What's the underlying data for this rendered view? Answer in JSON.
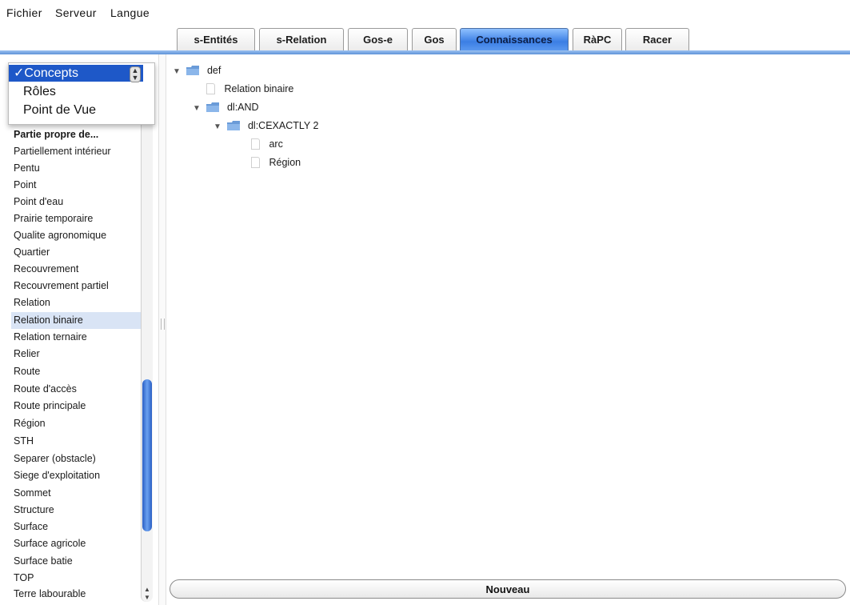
{
  "menubar": {
    "items": [
      "Fichier",
      "Serveur",
      "Langue"
    ]
  },
  "tabs": [
    {
      "label": "s-Entités",
      "active": false
    },
    {
      "label": "s-Relation",
      "active": false
    },
    {
      "label": "Gos-e",
      "active": false
    },
    {
      "label": "Gos",
      "active": false
    },
    {
      "label": "Connaissances",
      "active": true
    },
    {
      "label": "RàPC",
      "active": false
    },
    {
      "label": "Racer",
      "active": false
    }
  ],
  "category_dropdown": {
    "selected": "Concepts",
    "check_mark": "✓",
    "options": [
      "Concepts",
      "Rôles",
      "Point de Vue"
    ]
  },
  "concept_list": {
    "partial_first_item": "Partie propre de...",
    "items": [
      "Partiellement intérieur",
      "Pentu",
      "Point",
      "Point d'eau",
      "Prairie temporaire",
      "Qualite agronomique",
      "Quartier",
      "Recouvrement",
      "Recouvrement partiel",
      "Relation",
      "Relation binaire",
      "Relation ternaire",
      "Relier",
      "Route",
      "Route d'accès",
      "Route principale",
      "Région",
      "STH",
      "Separer (obstacle)",
      "Siege d'exploitation",
      "Sommet",
      "Structure",
      "Surface",
      "Surface agricole",
      "Surface batie",
      "TOP",
      "Terre labourable"
    ],
    "selected": "Relation binaire"
  },
  "tree": {
    "root": "def",
    "child_leaf": "Relation binaire",
    "and_node": "dl:AND",
    "exactly_node": "dl:CEXACTLY 2",
    "leaves": [
      "arc",
      "Région"
    ],
    "expanded_glyph": "▼"
  },
  "actions": {
    "new_label": "Nouveau"
  },
  "colors": {
    "active_tab": "#3b7ee4",
    "selection": "#1e58c8",
    "scroll_thumb": "#2a5fc4",
    "folder": "#6a9bd8"
  }
}
